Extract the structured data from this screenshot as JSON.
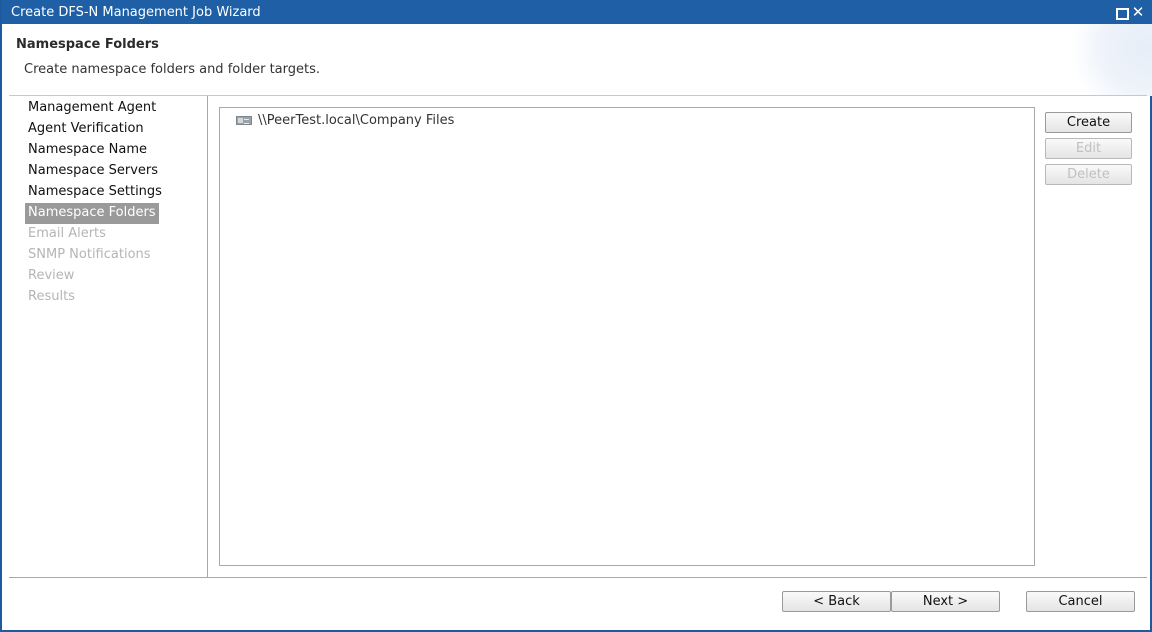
{
  "window": {
    "title": "Create DFS-N Management Job Wizard"
  },
  "header": {
    "title": "Namespace Folders",
    "subtitle": "Create namespace folders and folder targets."
  },
  "nav": {
    "items": [
      {
        "label": "Management Agent",
        "state": "normal"
      },
      {
        "label": "Agent Verification",
        "state": "normal"
      },
      {
        "label": "Namespace Name",
        "state": "normal"
      },
      {
        "label": "Namespace Servers",
        "state": "normal"
      },
      {
        "label": "Namespace Settings",
        "state": "normal"
      },
      {
        "label": "Namespace Folders",
        "state": "active"
      },
      {
        "label": "Email Alerts",
        "state": "disabled"
      },
      {
        "label": "SNMP Notifications",
        "state": "disabled"
      },
      {
        "label": "Review",
        "state": "disabled"
      },
      {
        "label": "Results",
        "state": "disabled"
      }
    ]
  },
  "tree": {
    "root_label": "\\\\PeerTest.local\\Company Files"
  },
  "actions": {
    "create": "Create",
    "edit": "Edit",
    "delete": "Delete"
  },
  "footer": {
    "back": "< Back",
    "next": "Next >",
    "cancel": "Cancel"
  },
  "colors": {
    "titlebar": "#1e5fa6",
    "nav_active": "#9a9a9a",
    "disabled_text": "#b5b5b5"
  }
}
